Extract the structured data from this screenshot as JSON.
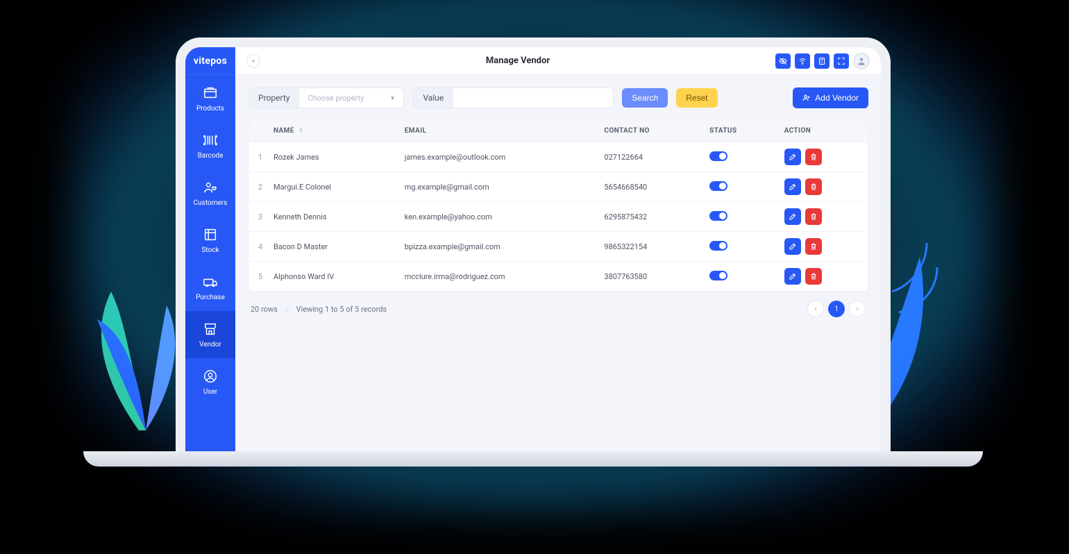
{
  "brand": "vitepos",
  "header": {
    "title": "Manage Vendor"
  },
  "sidebar": {
    "items": [
      {
        "label": "Products"
      },
      {
        "label": "Barcode"
      },
      {
        "label": "Customers"
      },
      {
        "label": "Stock"
      },
      {
        "label": "Purchase"
      },
      {
        "label": "Vendor"
      },
      {
        "label": "User"
      }
    ]
  },
  "filter": {
    "property_label": "Property",
    "property_placeholder": "Choose property",
    "value_label": "Value",
    "value": "",
    "search_label": "Search",
    "reset_label": "Reset",
    "add_label": "Add Vendor"
  },
  "table": {
    "columns": {
      "name": "NAME",
      "email": "EMAIL",
      "contact": "CONTACT NO",
      "status": "STATUS",
      "action": "ACTION"
    },
    "rows": [
      {
        "idx": "1",
        "name": "Rozek James",
        "email": "james.example@outlook.com",
        "contact": "027122664"
      },
      {
        "idx": "2",
        "name": "Margui.E Colonel",
        "email": "mg.example@gmail.com",
        "contact": "5654668540"
      },
      {
        "idx": "3",
        "name": "Kenneth Dennis",
        "email": "ken.example@yahoo.com",
        "contact": "6295875432"
      },
      {
        "idx": "4",
        "name": "Bacon D Master",
        "email": "bpizza.example@gmail.com",
        "contact": "9865322154"
      },
      {
        "idx": "5",
        "name": "Alphonso Ward IV",
        "email": "mcclure.irma@rodriguez.com",
        "contact": "3807763580"
      }
    ]
  },
  "footer": {
    "page_size": "20 rows",
    "viewing": "Viewing 1 to 5 of 5 records",
    "current_page": "1"
  }
}
